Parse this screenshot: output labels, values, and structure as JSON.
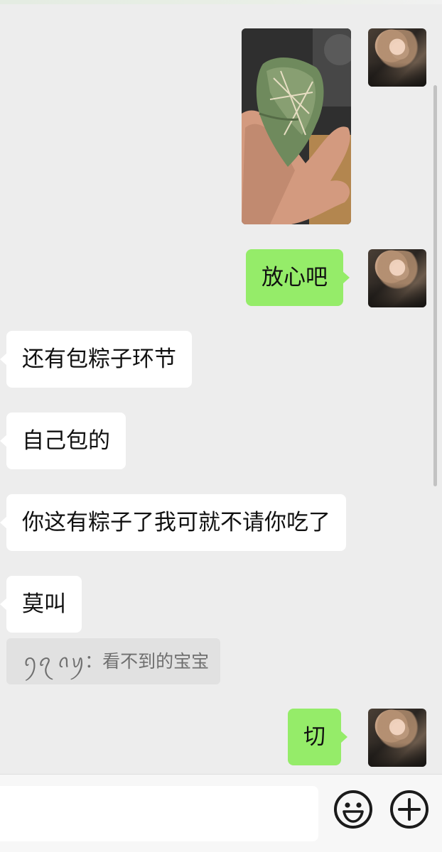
{
  "conversation": {
    "messages": [
      {
        "id": "m1",
        "from": "me",
        "kind": "image",
        "image_alt": "zongzi-in-hand-photo"
      },
      {
        "id": "m2",
        "from": "me",
        "kind": "text",
        "text": "放心吧"
      },
      {
        "id": "m3",
        "from": "them",
        "kind": "text",
        "text": "还有包粽子环节"
      },
      {
        "id": "m4",
        "from": "them",
        "kind": "text",
        "text": "自己包的"
      },
      {
        "id": "m5",
        "from": "them",
        "kind": "text",
        "text": "你这有粽子了我可就不请你吃了"
      },
      {
        "id": "m6",
        "from": "them",
        "kind": "text",
        "text": "莫叫"
      },
      {
        "id": "m7",
        "from": "me",
        "kind": "text",
        "text": "切"
      }
    ],
    "quote": {
      "author": "ꪆꪖ ꪒꪗ",
      "separator": "：",
      "text": "看不到的宝宝"
    }
  },
  "input_bar": {
    "placeholder": "",
    "emoji_icon": "emoji-face-icon",
    "more_icon": "plus-circle-icon"
  },
  "colors": {
    "background": "#ededed",
    "my_bubble": "#95ec69",
    "their_bubble": "#ffffff",
    "quote_bg": "#e1e1e1"
  }
}
